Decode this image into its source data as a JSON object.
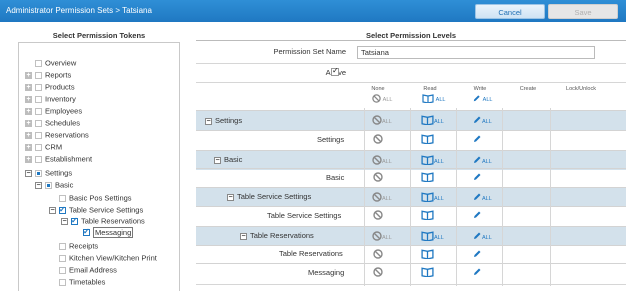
{
  "header": {
    "title": "Administrator Permission Sets > Tatsiana",
    "cancel_label": "Cancel",
    "save_label": "Save"
  },
  "left": {
    "heading": "Select Permission Tokens",
    "tree": [
      {
        "label": "Overview"
      },
      {
        "label": "Reports"
      },
      {
        "label": "Products"
      },
      {
        "label": "Inventory"
      },
      {
        "label": "Employees"
      },
      {
        "label": "Schedules"
      },
      {
        "label": "Reservations"
      },
      {
        "label": "CRM"
      },
      {
        "label": "Establishment"
      },
      {
        "label": "Settings"
      },
      {
        "label": "Basic"
      },
      {
        "label": "Basic Pos Settings"
      },
      {
        "label": "Table Service Settings"
      },
      {
        "label": "Table Reservations"
      },
      {
        "label": "Messaging"
      },
      {
        "label": "Receipts"
      },
      {
        "label": "Kitchen View/Kitchen Print"
      },
      {
        "label": "Email Address"
      },
      {
        "label": "Timetables"
      }
    ]
  },
  "right": {
    "heading": "Select Permission Levels",
    "name_label": "Permission Set Name",
    "name_value": "Tatsiana",
    "active_label": "Active",
    "columns": [
      "None",
      "Read",
      "Write",
      "Create",
      "Lock/Unlock"
    ],
    "all_label": "ALL",
    "rows": [
      {
        "label": "Settings"
      },
      {
        "label": "Settings"
      },
      {
        "label": "Basic"
      },
      {
        "label": "Basic"
      },
      {
        "label": "Table Service Settings"
      },
      {
        "label": "Table Service Settings"
      },
      {
        "label": "Table Reservations"
      },
      {
        "label": "Table Reservations"
      },
      {
        "label": "Messaging"
      }
    ]
  },
  "icons": {
    "none": "no-access-icon",
    "read": "open-book-icon",
    "write": "pencil-icon",
    "expand": "plus-box-icon",
    "collapse": "minus-box-icon"
  },
  "colors": {
    "titlebar": "#1f78c2",
    "accent": "#1f78c2",
    "shaded_row": "#d3e1eb"
  }
}
